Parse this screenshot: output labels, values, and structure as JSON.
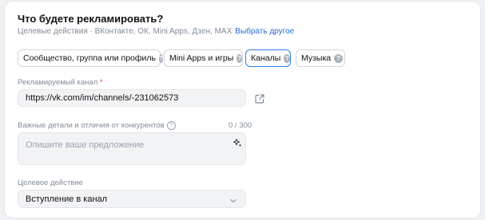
{
  "header": {
    "title": "Что будете рекламировать?",
    "subtitle": "Целевые действия · ВКонтакте, ОК, Mini Apps, Дзен, MAX",
    "choose_other": "Выбрать другое"
  },
  "chips": [
    {
      "label": "Сообщество, группа или профиль",
      "icon": "question-icon",
      "selected": false
    },
    {
      "label": "Mini Apps и игры",
      "icon": "question-icon",
      "selected": false
    },
    {
      "label": "Каналы",
      "icon": "question-icon",
      "selected": true
    },
    {
      "label": "Музыка",
      "icon": "question-icon",
      "selected": false
    }
  ],
  "channel": {
    "label": "Рекламируемый канал",
    "required_mark": "*",
    "value": "https://vk.com/im/channels/-231062573",
    "open_icon": "external-link-icon"
  },
  "details": {
    "label": "Важные детали и отличия от конкурентов",
    "info_icon": "info-icon",
    "counter": "0 / 300",
    "placeholder": "Опишите ваше предложение",
    "ai_icon": "sparkle-icon"
  },
  "target_action": {
    "label": "Целевое действие",
    "value": "Вступление в канал",
    "chevron_icon": "chevron-down-icon"
  },
  "colors": {
    "accent": "#2d81e0",
    "link": "#2a6bd6",
    "required": "#e64646",
    "field_bg": "#f2f3f5"
  }
}
